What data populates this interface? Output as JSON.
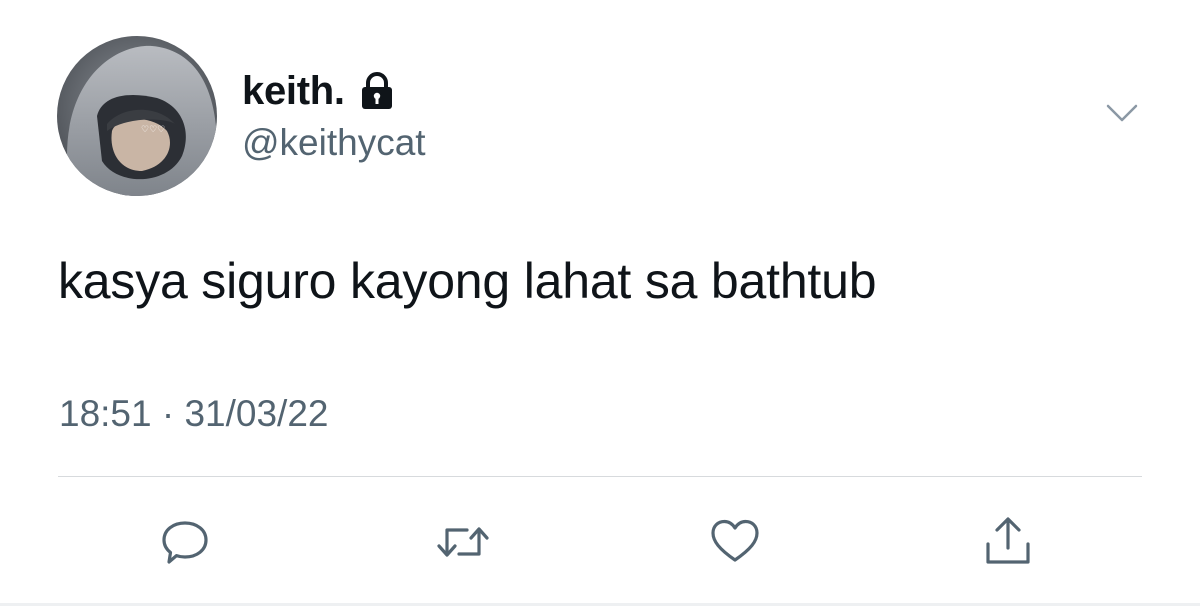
{
  "tweet": {
    "display_name": "keith.",
    "handle": "@keithycat",
    "protected_icon": "lock-icon",
    "text": "kasya siguro kayong lahat sa bathtub",
    "timestamp": "18:51 · 31/03/22"
  },
  "actions": [
    {
      "name": "reply",
      "icon": "speech-bubble-icon"
    },
    {
      "name": "retweet",
      "icon": "retweet-arrows-icon"
    },
    {
      "name": "like",
      "icon": "heart-icon"
    },
    {
      "name": "share",
      "icon": "share-upload-icon"
    }
  ],
  "colors": {
    "primary_text": "#0f1419",
    "secondary_text": "#536471",
    "icon_gray": "#536471",
    "divider": "#d7dadd"
  }
}
